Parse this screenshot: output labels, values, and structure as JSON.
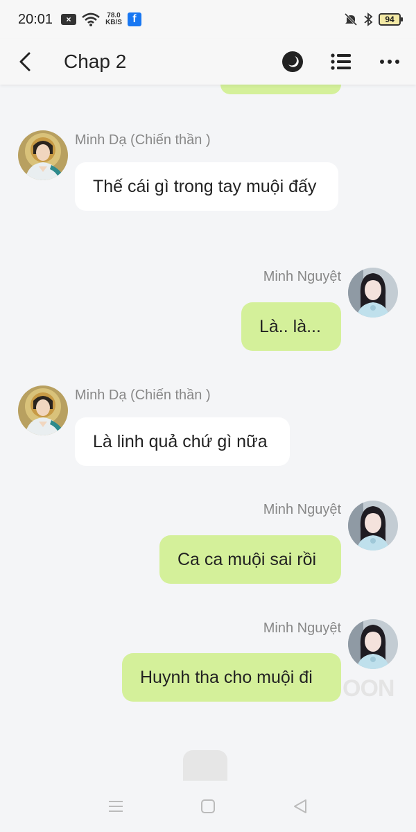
{
  "status_bar": {
    "time": "20:01",
    "net_speed_value": "78.0",
    "net_speed_unit": "KB/S",
    "battery": "94",
    "icons": [
      "notification-x-icon",
      "wifi-icon",
      "facebook-icon",
      "mute-icon",
      "bluetooth-icon",
      "battery-icon"
    ]
  },
  "header": {
    "title": "Chap 2",
    "icons": [
      "back-icon",
      "night-mode-icon",
      "list-icon",
      "more-icon"
    ]
  },
  "messages": [
    {
      "side": "left",
      "sender": "Minh Dạ (Chiến thần )",
      "text": "Thế cái gì trong tay muội đấy"
    },
    {
      "side": "right",
      "sender": "Minh Nguyệt",
      "text": "Là.. là..."
    },
    {
      "side": "left",
      "sender": "Minh Dạ (Chiến thần )",
      "text": "Là linh quả chứ gì nữa"
    },
    {
      "side": "right",
      "sender": "Minh Nguyệt",
      "text": "Ca ca muội sai rồi"
    },
    {
      "side": "right",
      "sender": "Minh Nguyệt",
      "text": "Huynh tha cho muội đi"
    }
  ],
  "watermark": "OON",
  "colors": {
    "background": "#f4f5f7",
    "left_bubble": "#ffffff",
    "right_bubble": "#d4f09a",
    "sender_name": "#888888"
  },
  "nav_bar": {
    "icons": [
      "menu-icon",
      "home-icon",
      "back-triangle-icon"
    ]
  }
}
